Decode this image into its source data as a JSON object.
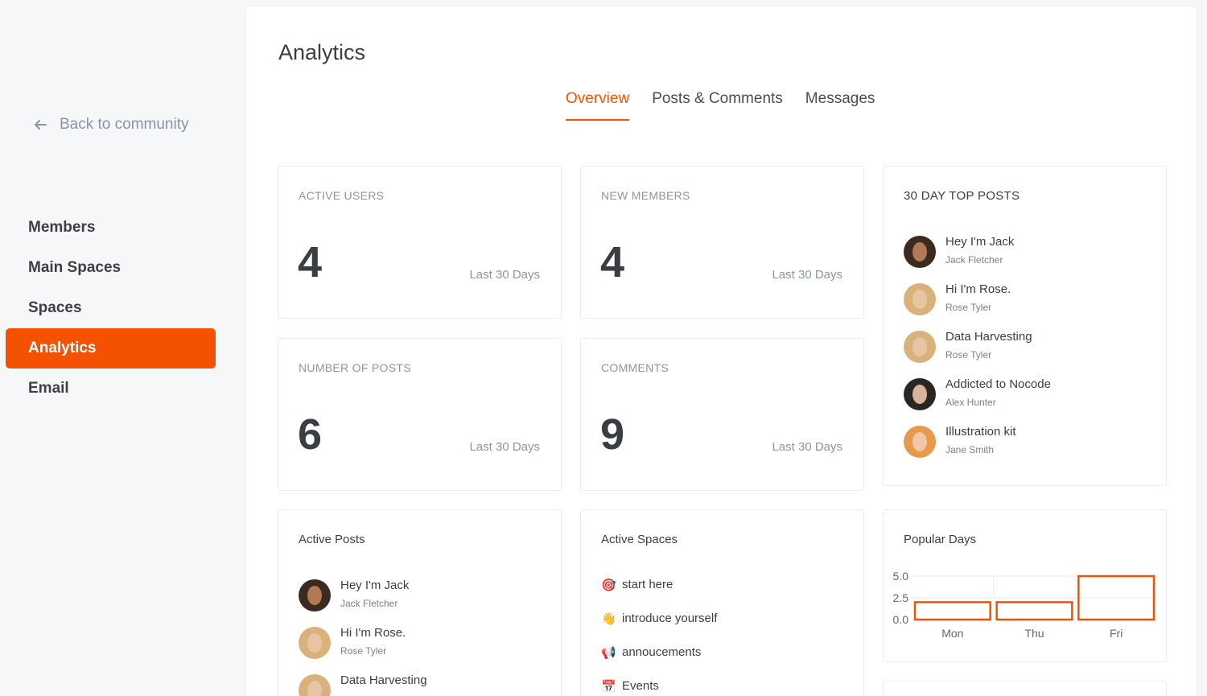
{
  "sidebar": {
    "back_label": "Back to community",
    "items": [
      {
        "label": "Members",
        "active": false
      },
      {
        "label": "Main Spaces",
        "active": false
      },
      {
        "label": "Spaces",
        "active": false
      },
      {
        "label": "Analytics",
        "active": true
      },
      {
        "label": "Email",
        "active": false
      }
    ]
  },
  "main": {
    "title": "Analytics",
    "tabs": [
      {
        "label": "Overview",
        "active": true
      },
      {
        "label": "Posts & Comments",
        "active": false
      },
      {
        "label": "Messages",
        "active": false
      }
    ],
    "stats": [
      {
        "label": "ACTIVE USERS",
        "value": "4",
        "period": "Last 30 Days"
      },
      {
        "label": "NEW MEMBERS",
        "value": "4",
        "period": "Last 30 Days"
      },
      {
        "label": "NUMBER OF POSTS",
        "value": "6",
        "period": "Last 30 Days"
      },
      {
        "label": "COMMENTS",
        "value": "9",
        "period": "Last 30 Days"
      }
    ],
    "top_posts": {
      "title": "30 DAY TOP POSTS",
      "items": [
        {
          "title": "Hey I'm Jack",
          "author": "Jack Fletcher",
          "avatar": "jack"
        },
        {
          "title": "Hi I'm Rose.",
          "author": "Rose Tyler",
          "avatar": "rose"
        },
        {
          "title": "Data Harvesting",
          "author": "Rose Tyler",
          "avatar": "rose"
        },
        {
          "title": "Addicted to Nocode",
          "author": "Alex Hunter",
          "avatar": "alex"
        },
        {
          "title": "Illustration kit",
          "author": "Jane Smith",
          "avatar": "jane"
        }
      ]
    },
    "active_posts": {
      "title": "Active Posts",
      "items": [
        {
          "title": "Hey I'm Jack",
          "author": "Jack Fletcher",
          "avatar": "jack"
        },
        {
          "title": "Hi I'm Rose.",
          "author": "Rose Tyler",
          "avatar": "rose"
        },
        {
          "title": "Data Harvesting",
          "author": "",
          "avatar": "rose"
        }
      ]
    },
    "active_spaces": {
      "title": "Active Spaces",
      "items": [
        {
          "emoji": "🎯",
          "icon": "target-icon",
          "label": "start here"
        },
        {
          "emoji": "👋",
          "icon": "wave-icon",
          "label": "introduce yourself"
        },
        {
          "emoji": "📢",
          "icon": "megaphone-icon",
          "label": "annoucements"
        },
        {
          "emoji": "📅",
          "icon": "calendar-icon",
          "label": "Events"
        }
      ]
    },
    "popular_days": {
      "title": "Popular Days"
    }
  },
  "avatar_colors": {
    "jack": {
      "bg": "#3b2a20",
      "face": "#b07a55"
    },
    "rose": {
      "bg": "#d8b27a",
      "face": "#e9c4a2"
    },
    "alex": {
      "bg": "#2a2624",
      "face": "#d9b49a"
    },
    "jane": {
      "bg": "#e59a4e",
      "face": "#f0c8a8"
    }
  },
  "accent": "#f55200",
  "chart_data": {
    "type": "bar",
    "categories": [
      "Mon",
      "Thu",
      "Fri"
    ],
    "values": [
      2,
      2,
      5
    ],
    "yticks": [
      "0.0",
      "2.5",
      "5.0"
    ],
    "ylim": [
      0,
      5
    ],
    "color": "#f55200"
  }
}
